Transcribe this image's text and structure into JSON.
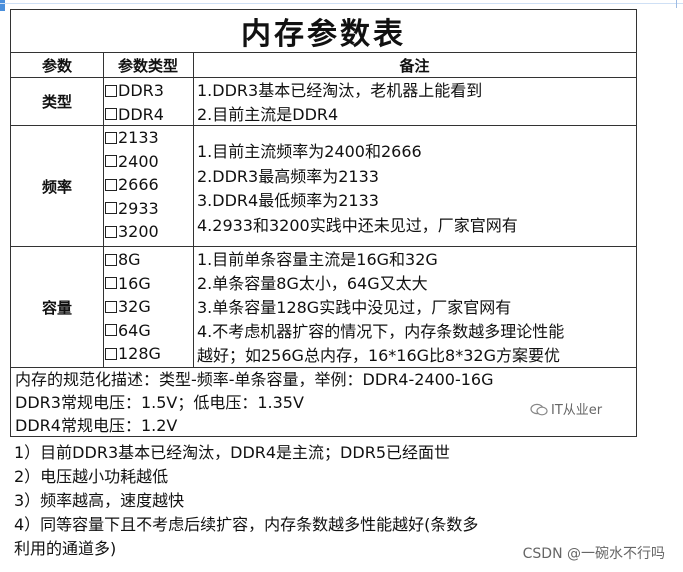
{
  "table": {
    "title": "内存参数表",
    "headers": {
      "param": "参数",
      "param_type": "参数类型",
      "notes": "备注"
    },
    "rows": {
      "type": {
        "label": "类型",
        "options": [
          "DDR3",
          "DDR4"
        ],
        "notes": [
          "1.DDR3基本已经淘汰，老机器上能看到",
          "2.目前主流是DDR4"
        ]
      },
      "freq": {
        "label": "频率",
        "options": [
          "2133",
          "2400",
          "2666",
          "2933",
          "3200"
        ],
        "notes": [
          "1.目前主流频率为2400和2666",
          "2.DDR3最高频率为2133",
          "3.DDR4最低频率为2133",
          "4.2933和3200实践中还未见过，厂家官网有"
        ]
      },
      "capacity": {
        "label": "容量",
        "options": [
          "8G",
          "16G",
          "32G",
          "64G",
          "128G"
        ],
        "notes": [
          "1.目前单条容量主流是16G和32G",
          "2.单条容量8G太小，64G又太大",
          "3.单条容量128G实践中没见过，厂家官网有",
          "4.不考虑机器扩容的情况下，内存条数越多理论性能",
          "越好；如256G总内存，16*16G比8*32G方案要优"
        ]
      }
    },
    "footer": [
      "内存的规范化描述：类型-频率-单条容量，举例：DDR4-2400-16G",
      "DDR3常规电压：1.5V；低电压：1.35V",
      "DDR4常规电压：1.2V"
    ],
    "watermark": "IT从业er"
  },
  "list": [
    "1）目前DDR3基本已经淘汰，DDR4是主流；DDR5已经面世",
    "2）电压越小功耗越低",
    "3）频率越高，速度越快",
    "4）同等容量下且不考虑后续扩容，内存条数越多性能越好(条数多",
    "利用的通道多)"
  ],
  "credit": "CSDN @一碗水不行吗"
}
